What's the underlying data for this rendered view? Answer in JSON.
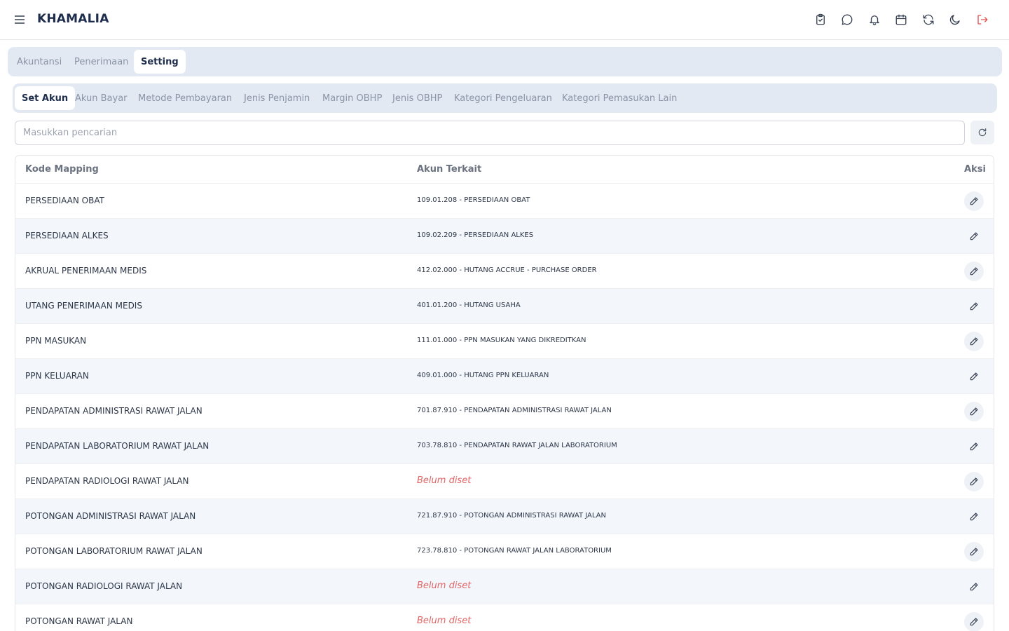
{
  "app": {
    "brand": "KHAMALIA"
  },
  "header_icons": [
    "menu-icon",
    "clipboard-check-icon",
    "chat-bubble-icon",
    "bell-icon",
    "calendar-icon",
    "refresh-icon",
    "moon-icon",
    "logout-icon"
  ],
  "colors": {
    "accent": "#1f2d4d",
    "tab_bar": "#e3e9f3",
    "unset": "#e06666",
    "logout": "#e05252",
    "row_alt": "#f3f7fc"
  },
  "tabs_top": [
    {
      "label": "Akuntansi",
      "active": false
    },
    {
      "label": "Penerimaan",
      "active": false
    },
    {
      "label": "Setting",
      "active": true
    }
  ],
  "tabs_sub": [
    {
      "label": "Set Akun",
      "active": true
    },
    {
      "label": "Akun Bayar",
      "active": false
    },
    {
      "label": "Metode Pembayaran",
      "active": false
    },
    {
      "label": "Jenis Penjamin",
      "active": false
    },
    {
      "label": "Margin OBHP",
      "active": false
    },
    {
      "label": "Jenis OBHP",
      "active": false
    },
    {
      "label": "Kategori Pengeluaran",
      "active": false
    },
    {
      "label": "Kategori Pemasukan Lain",
      "active": false
    }
  ],
  "search": {
    "placeholder": "Masukkan pencarian",
    "value": ""
  },
  "table": {
    "headers": {
      "kode": "Kode Mapping",
      "akun": "Akun Terkait",
      "aksi": "Aksi"
    },
    "rows": [
      {
        "kode": "PERSEDIAAN OBAT",
        "akun": "109.01.208 - PERSEDIAAN OBAT",
        "unset": false
      },
      {
        "kode": "PERSEDIAAN ALKES",
        "akun": "109.02.209 - PERSEDIAAN ALKES",
        "unset": false
      },
      {
        "kode": "AKRUAL PENERIMAAN MEDIS",
        "akun": "412.02.000 - HUTANG ACCRUE - PURCHASE ORDER",
        "unset": false
      },
      {
        "kode": "UTANG PENERIMAAN MEDIS",
        "akun": "401.01.200 - HUTANG USAHA",
        "unset": false
      },
      {
        "kode": "PPN MASUKAN",
        "akun": "111.01.000 - PPN MASUKAN YANG DIKREDITKAN",
        "unset": false
      },
      {
        "kode": "PPN KELUARAN",
        "akun": "409.01.000 - HUTANG PPN KELUARAN",
        "unset": false
      },
      {
        "kode": "PENDAPATAN ADMINISTRASI RAWAT JALAN",
        "akun": "701.87.910 - PENDAPATAN ADMINISTRASI RAWAT JALAN",
        "unset": false
      },
      {
        "kode": "PENDAPATAN LABORATORIUM RAWAT JALAN",
        "akun": "703.78.810 - PENDAPATAN RAWAT JALAN LABORATORIUM",
        "unset": false
      },
      {
        "kode": "PENDAPATAN RADIOLOGI RAWAT JALAN",
        "akun": "Belum diset",
        "unset": true
      },
      {
        "kode": "POTONGAN ADMINISTRASI RAWAT JALAN",
        "akun": "721.87.910 - POTONGAN ADMINISTRASI RAWAT JALAN",
        "unset": false
      },
      {
        "kode": "POTONGAN LABORATORIUM RAWAT JALAN",
        "akun": "723.78.810 - POTONGAN RAWAT JALAN LABORATORIUM",
        "unset": false
      },
      {
        "kode": "POTONGAN RADIOLOGI RAWAT JALAN",
        "akun": "Belum diset",
        "unset": true
      },
      {
        "kode": "POTONGAN RAWAT JALAN",
        "akun": "Belum diset",
        "unset": true
      }
    ]
  }
}
